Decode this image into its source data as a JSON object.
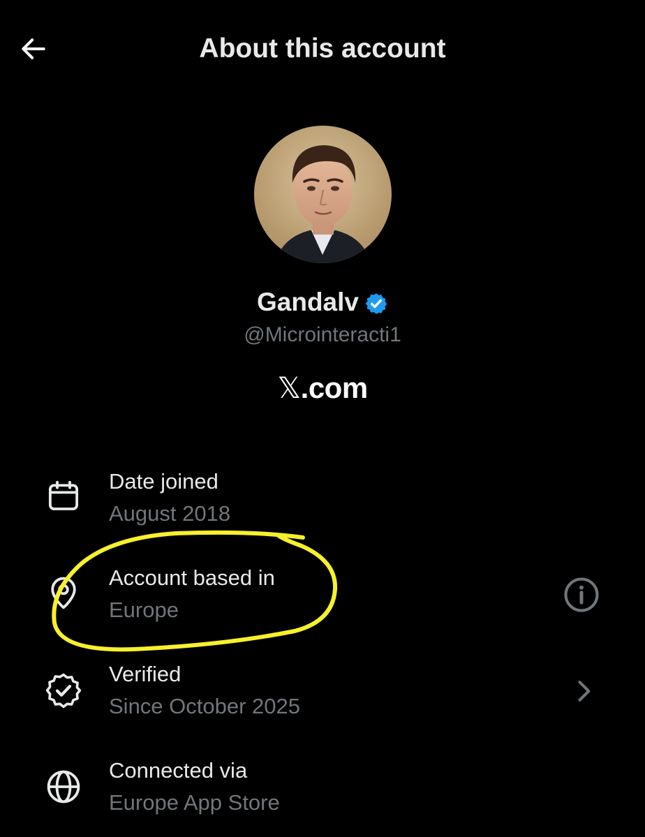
{
  "header": {
    "title": "About this account"
  },
  "profile": {
    "display_name": "Gandalv",
    "handle": "@Microinteracti1",
    "brand_symbol": "𝕏",
    "brand_suffix": ".com"
  },
  "colors": {
    "background": "#000000",
    "primary_text": "#e7e9ea",
    "secondary_text": "#71767b",
    "verified_blue": "#1d9bf0",
    "highlight_yellow": "#f6f12a"
  },
  "rows": [
    {
      "icon": "calendar-icon",
      "label": "Date joined",
      "value": "August 2018"
    },
    {
      "icon": "location-pin-icon",
      "label": "Account based in",
      "value": "Europe",
      "action_icon": "info-icon"
    },
    {
      "icon": "verified-seal-icon",
      "label": "Verified",
      "value": "Since October 2025",
      "action_icon": "chevron-right-icon"
    },
    {
      "icon": "globe-icon",
      "label": "Connected via",
      "value": "Europe App Store"
    }
  ]
}
